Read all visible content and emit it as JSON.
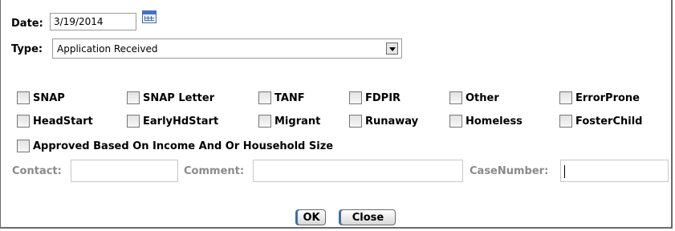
{
  "date": {
    "label": "Date:",
    "value": "3/19/2014",
    "icon": "calendar-icon"
  },
  "type": {
    "label": "Type:",
    "selected": "Application Received"
  },
  "checkboxes": [
    {
      "label": "SNAP",
      "checked": false
    },
    {
      "label": "SNAP Letter",
      "checked": false
    },
    {
      "label": "TANF",
      "checked": false
    },
    {
      "label": "FDPIR",
      "checked": false
    },
    {
      "label": "Other",
      "checked": false
    },
    {
      "label": "ErrorProne",
      "checked": false
    },
    {
      "label": "HeadStart",
      "checked": false
    },
    {
      "label": "EarlyHdStart",
      "checked": false
    },
    {
      "label": "Migrant",
      "checked": false
    },
    {
      "label": "Runaway",
      "checked": false
    },
    {
      "label": "Homeless",
      "checked": false
    },
    {
      "label": "FosterChild",
      "checked": false
    },
    {
      "label": "Approved Based On Income And Or Household Size",
      "checked": false
    }
  ],
  "fields": {
    "contact_label": "Contact:",
    "contact_value": "",
    "comment_label": "Comment:",
    "comment_value": "",
    "casenumber_label": "CaseNumber:",
    "casenumber_value": ""
  },
  "buttons": {
    "ok": "OK",
    "close": "Close"
  },
  "colors": {
    "accent": "#2f6fbd",
    "muted_label": "#8a8a8a"
  }
}
